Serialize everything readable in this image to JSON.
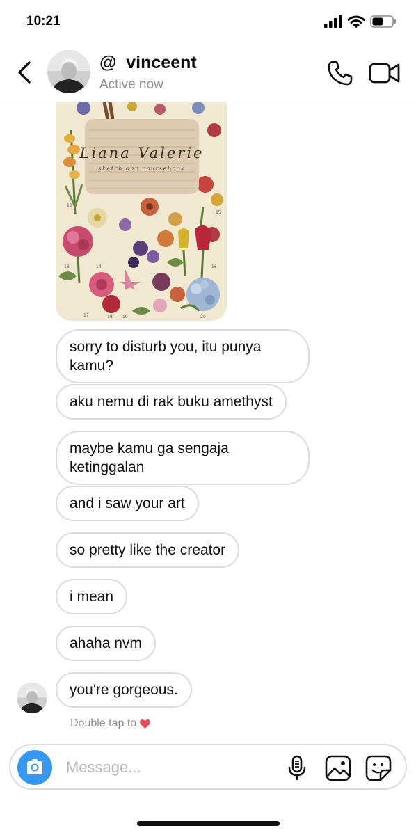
{
  "status_bar": {
    "time": "10:21",
    "icons": [
      "signal-icon",
      "wifi-icon",
      "battery-icon"
    ]
  },
  "header": {
    "username": "@_vinceent",
    "subtitle": "Active now",
    "icons": [
      "back-chevron-icon",
      "phone-icon",
      "video-camera-icon"
    ]
  },
  "artwork": {
    "title": "Liana Valerie",
    "subtitle": "sketch dan coursebook",
    "plate_numbers": [
      "10",
      "13",
      "14",
      "15",
      "16",
      "17",
      "18",
      "19",
      "20"
    ]
  },
  "messages": [
    {
      "text": "sorry to disturb you, itu punya kamu?"
    },
    {
      "text": "aku nemu di rak buku amethyst"
    },
    {
      "text": "maybe kamu ga sengaja ketinggalan"
    },
    {
      "text": "and i saw your art"
    },
    {
      "text": "so pretty like the creator"
    },
    {
      "text": "i mean"
    },
    {
      "text": "ahaha nvm"
    },
    {
      "text": "you're gorgeous."
    }
  ],
  "hint": "Double tap to",
  "composer": {
    "placeholder": "Message...",
    "icons": [
      "camera-icon",
      "microphone-icon",
      "gallery-icon",
      "sticker-icon"
    ]
  },
  "colors": {
    "accent": "#3897f0",
    "heart": "#ed4956",
    "bubble_border": "#dbdbdb",
    "muted": "#8e8e8e"
  }
}
